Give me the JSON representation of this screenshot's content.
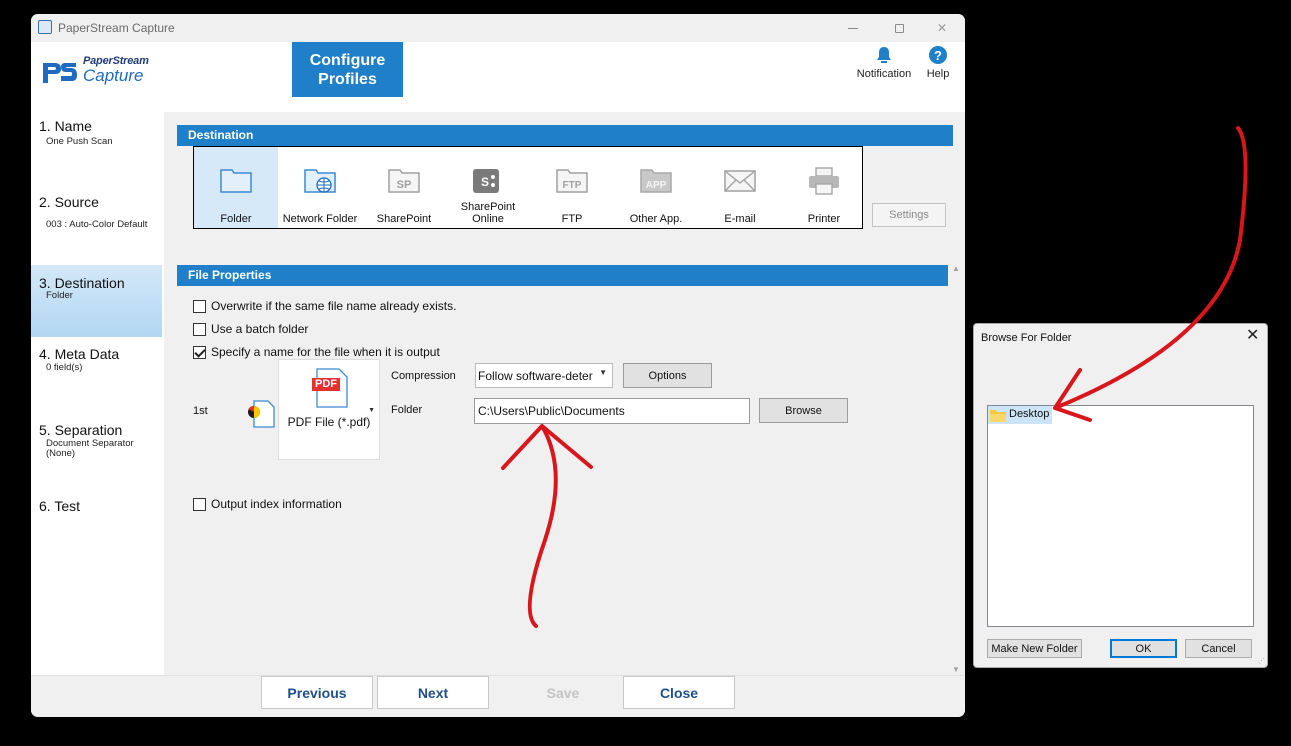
{
  "window": {
    "title": "PaperStream Capture",
    "logo_line1": "PaperStream",
    "logo_line2": "Capture",
    "configure_line1": "Configure",
    "configure_line2": "Profiles",
    "notification_label": "Notification",
    "help_label": "Help"
  },
  "sidebar": {
    "items": [
      {
        "title": "1. Name",
        "sub": "One Push Scan"
      },
      {
        "title": "2. Source",
        "sub": "003 : Auto-Color Default"
      },
      {
        "title": "3. Destination",
        "sub": "Folder"
      },
      {
        "title": "4. Meta Data",
        "sub": "0 field(s)"
      },
      {
        "title": "5. Separation",
        "sub": "Document Separator",
        "sub2": "(None)"
      },
      {
        "title": "6. Test",
        "sub": ""
      }
    ]
  },
  "destination": {
    "header": "Destination",
    "options": [
      "Folder",
      "Network Folder",
      "SharePoint",
      "SharePoint Online",
      "FTP",
      "Other App.",
      "E-mail",
      "Printer"
    ],
    "selected": "Folder",
    "settings_label": "Settings"
  },
  "file_properties": {
    "header": "File Properties",
    "overwrite_label": "Overwrite if the same file name already exists.",
    "overwrite_checked": false,
    "batch_label": "Use a batch folder",
    "batch_checked": false,
    "specify_label": "Specify a name for the file when it is output",
    "specify_checked": true,
    "order_label": "1st",
    "file_type_badge": "PDF",
    "file_type": "PDF File (*.pdf)",
    "compression_label": "Compression",
    "compression_value": "Follow software-deter",
    "options_label": "Options",
    "folder_label": "Folder",
    "folder_value": "C:\\Users\\Public\\Documents",
    "browse_label": "Browse",
    "output_index_label": "Output index information",
    "output_index_checked": false
  },
  "footer": {
    "previous": "Previous",
    "next": "Next",
    "save": "Save",
    "close": "Close"
  },
  "browse_dialog": {
    "title": "Browse For Folder",
    "tree_item": "Desktop",
    "make_new_folder": "Make New Folder",
    "ok": "OK",
    "cancel": "Cancel"
  },
  "colors": {
    "accent_blue": "#1f7fc9",
    "annotation_red": "#d9161b"
  }
}
